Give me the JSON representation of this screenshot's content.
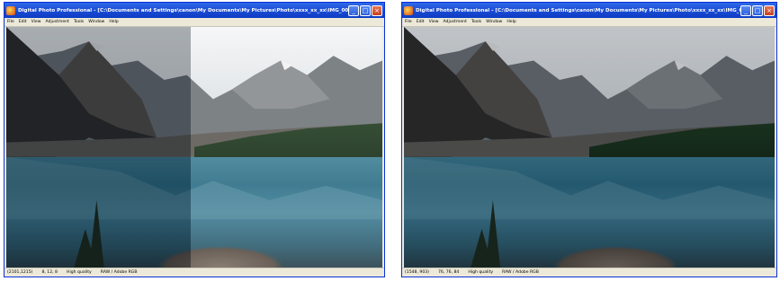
{
  "windows": [
    {
      "title": "Digital Photo Professional - [C:\\Documents and Settings\\canon\\My Documents\\My Pictures\\Photo\\xxxx_xx_xx\\IMG_0006.CR2 *]",
      "menu": [
        "File",
        "Edit",
        "View",
        "Adjustment",
        "Tools",
        "Window",
        "Help"
      ],
      "status": {
        "coords": "(2101,1215)",
        "rgb": "8, 12, 8",
        "quality": "High quality",
        "profile": "RAW / Adobe RGB"
      },
      "preview_mode": "split-comparison"
    },
    {
      "title": "Digital Photo Professional - [C:\\Documents and Settings\\canon\\My Documents\\My Pictures\\Photo\\xxxx_xx_xx\\IMG_0006.CR2 *]",
      "menu": [
        "File",
        "Edit",
        "View",
        "Adjustment",
        "Tools",
        "Window",
        "Help"
      ],
      "status": {
        "coords": "(1548, 903)",
        "rgb": "76, 76, 84",
        "quality": "High quality",
        "profile": "RAW / Adobe RGB"
      },
      "preview_mode": "full-adjusted"
    }
  ],
  "icons": {
    "app": "app-icon",
    "minimize": "minimize-icon",
    "maximize": "maximize-icon",
    "close": "close-icon"
  },
  "controls": {
    "minimize": "_",
    "maximize": "□",
    "close": "×"
  },
  "colors": {
    "titlebar": "#1d4fd6",
    "frame": "#ece9d8",
    "close": "#c4401e"
  }
}
